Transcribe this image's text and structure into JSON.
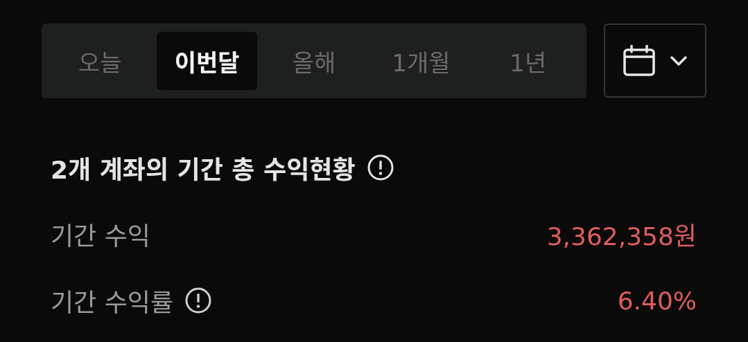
{
  "tabs": [
    {
      "label": "오늘",
      "selected": false
    },
    {
      "label": "이번달",
      "selected": true
    },
    {
      "label": "올해",
      "selected": false
    },
    {
      "label": "1개월",
      "selected": false
    },
    {
      "label": "1년",
      "selected": false
    }
  ],
  "summary": {
    "title": "2개 계좌의 기간 총 수익현황",
    "rows": [
      {
        "label": "기간 수익",
        "value": "3,362,358원",
        "info": false
      },
      {
        "label": "기간 수익률",
        "value": "6.40%",
        "info": true
      }
    ]
  }
}
